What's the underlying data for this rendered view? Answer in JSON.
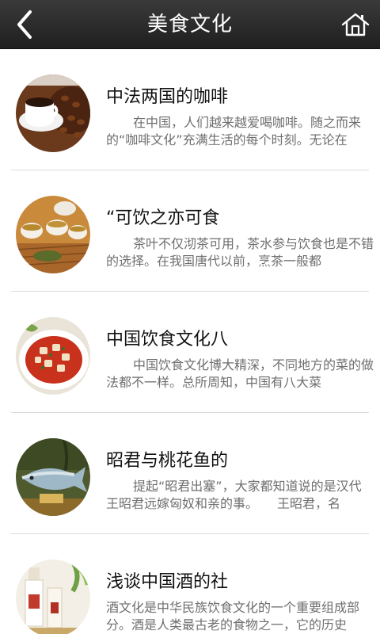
{
  "header": {
    "title": "美食文化",
    "back_icon": "chevron-left-icon",
    "home_icon": "home-icon"
  },
  "articles": [
    {
      "title": "中法两国的咖啡",
      "summary": "在中国，人们越来越爱喝咖啡。随之而来的“咖啡文化”充满生活的每个时刻。无论在",
      "image": "coffee-cup"
    },
    {
      "title": "“可饮之亦可食",
      "summary": "茶叶不仅沏茶可用，茶水参与饮食也是不错的选择。在我国唐代以前，烹茶一般都",
      "image": "tea-set"
    },
    {
      "title": "中国饮食文化八",
      "summary": "中国饮食文化博大精深，不同地方的菜的做法都不一样。总所周知，中国有八大菜",
      "image": "mapo-tofu"
    },
    {
      "title": "昭君与桃花鱼的",
      "summary": "提起“昭君出塞”，大家都知道说的是汉代王昭君远嫁匈奴和亲的事。　　王昭君，名",
      "image": "peach-blossom-fish"
    },
    {
      "title": "浅谈中国酒的社",
      "summary": "酒文化是中华民族饮食文化的一个重要组成部分。酒是人类最古老的食物之一，它的历史",
      "image": "liquor-bottles"
    }
  ]
}
